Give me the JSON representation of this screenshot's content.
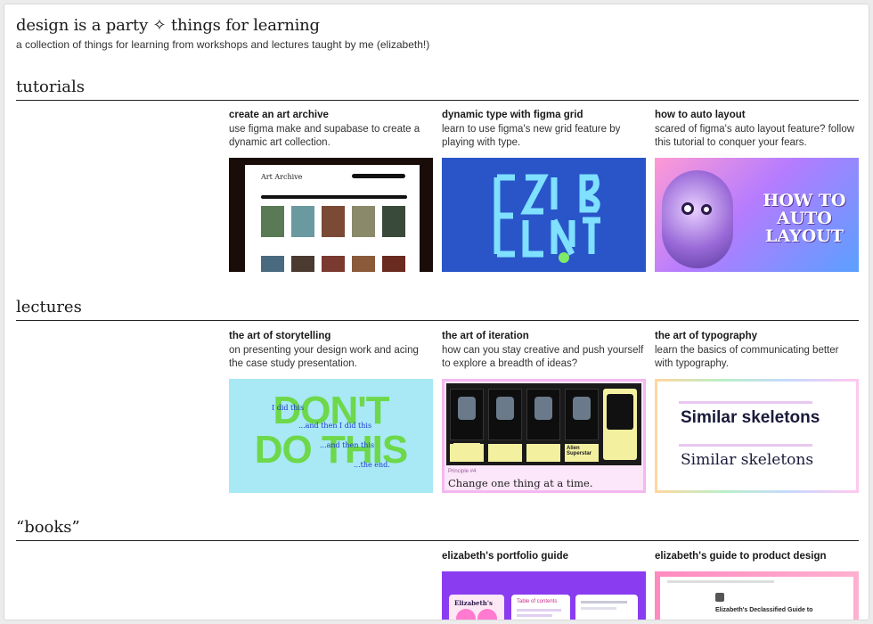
{
  "header": {
    "title": "design is a party ✧ things for learning",
    "subtitle": "a collection of things for learning from workshops and lectures taught by me (elizabeth!)"
  },
  "sections": {
    "tutorials": {
      "heading": "tutorials",
      "cards": [
        {
          "title": "create an art archive",
          "desc": "use figma make and supabase to create a dynamic art collection.",
          "thumb_text": "Art Archive"
        },
        {
          "title": "dynamic type with figma grid",
          "desc": "learn to use figma's new grid feature by playing with type.",
          "thumb_text": "ELIZABETH"
        },
        {
          "title": "how to auto layout",
          "desc": "scared of figma's auto layout feature? follow this tutorial to conquer your fears.",
          "thumb_lines": [
            "HOW TO",
            "AUTO",
            "LAYOUT"
          ]
        }
      ]
    },
    "lectures": {
      "heading": "lectures",
      "cards": [
        {
          "title": "the art of storytelling",
          "desc": "on presenting your design work and acing the case study presentation.",
          "thumb_big": [
            "DON'T",
            "DO THIS"
          ],
          "thumb_small": [
            "I did this",
            "...and then I did this",
            "...and then this",
            "...the end."
          ]
        },
        {
          "title": "the art of iteration",
          "desc": "how can you stay creative and push yourself to explore a breadth of ideas?",
          "thumb_caption": "Change one thing at a time.",
          "thumb_small": "Principle #4",
          "thumb_card_label": "Alien Superstar"
        },
        {
          "title": "the art of typography",
          "desc": "learn the basics of communicating better with typography.",
          "thumb_lines": [
            "Similar skeletons",
            "Similar skeletons"
          ]
        }
      ]
    },
    "books": {
      "heading": "“books”",
      "cards": [
        {
          "title": "elizabeth's portfolio guide",
          "thumb_texts": [
            "Elizabeth's",
            "Table of contents"
          ]
        },
        {
          "title": "elizabeth's guide to product design",
          "thumb_text": "Elizabeth's Declassified Guide to"
        }
      ]
    }
  },
  "colors": {
    "rule": "#222222",
    "blue_thumb": "#2a55c9",
    "type_cyan": "#7fe0ff",
    "story_bg": "#a9e8f5",
    "story_green": "#6dd84a",
    "iteration_border": "#f3b8f0",
    "purple_thumb": "#8a3cf0"
  }
}
